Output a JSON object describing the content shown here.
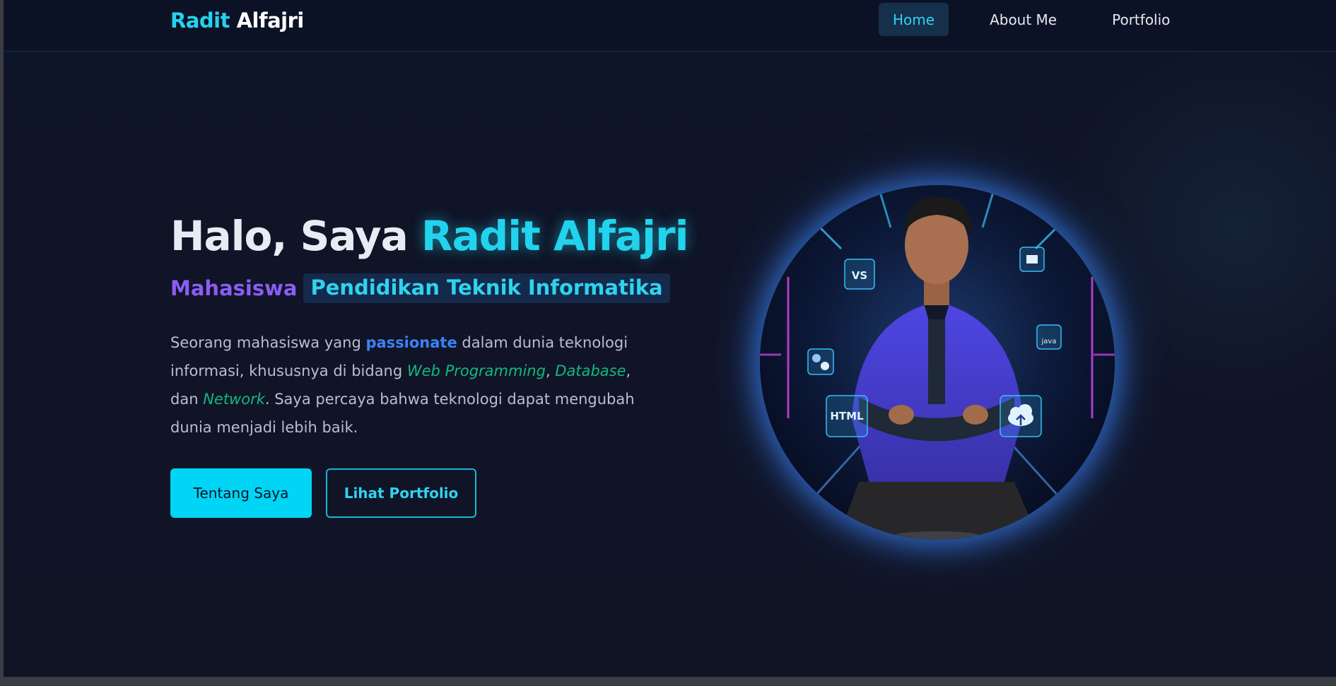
{
  "brand": {
    "first": "Radit",
    "last": "Alfajri"
  },
  "nav": {
    "items": [
      {
        "label": "Home",
        "active": true
      },
      {
        "label": "About Me",
        "active": false
      },
      {
        "label": "Portfolio",
        "active": false
      }
    ]
  },
  "hero": {
    "title_prefix": "Halo, Saya",
    "title_name": "Radit Alfajri",
    "role": "Mahasiswa",
    "major": "Pendidikan Teknik Informatika",
    "desc": {
      "p1": "Seorang mahasiswa yang ",
      "kw": "passionate",
      "p2": " dalam dunia teknologi informasi, khususnya di bidang ",
      "em1": "Web Programming",
      "sep1": ", ",
      "em2": "Database",
      "sep2": ", dan ",
      "em3": "Network",
      "p3": ". Saya percaya bahwa teknologi dapat mengubah dunia menjadi lebih baik."
    },
    "btn_primary": "Tentang Saya",
    "btn_secondary": "Lihat Portfolio"
  },
  "photo": {
    "icons": [
      "VS",
      "HTML",
      "java"
    ]
  },
  "colors": {
    "accent": "#22d3ee",
    "purple": "#8b5cf6",
    "blue": "#3b82f6",
    "green": "#10b981",
    "background": "#101426"
  }
}
